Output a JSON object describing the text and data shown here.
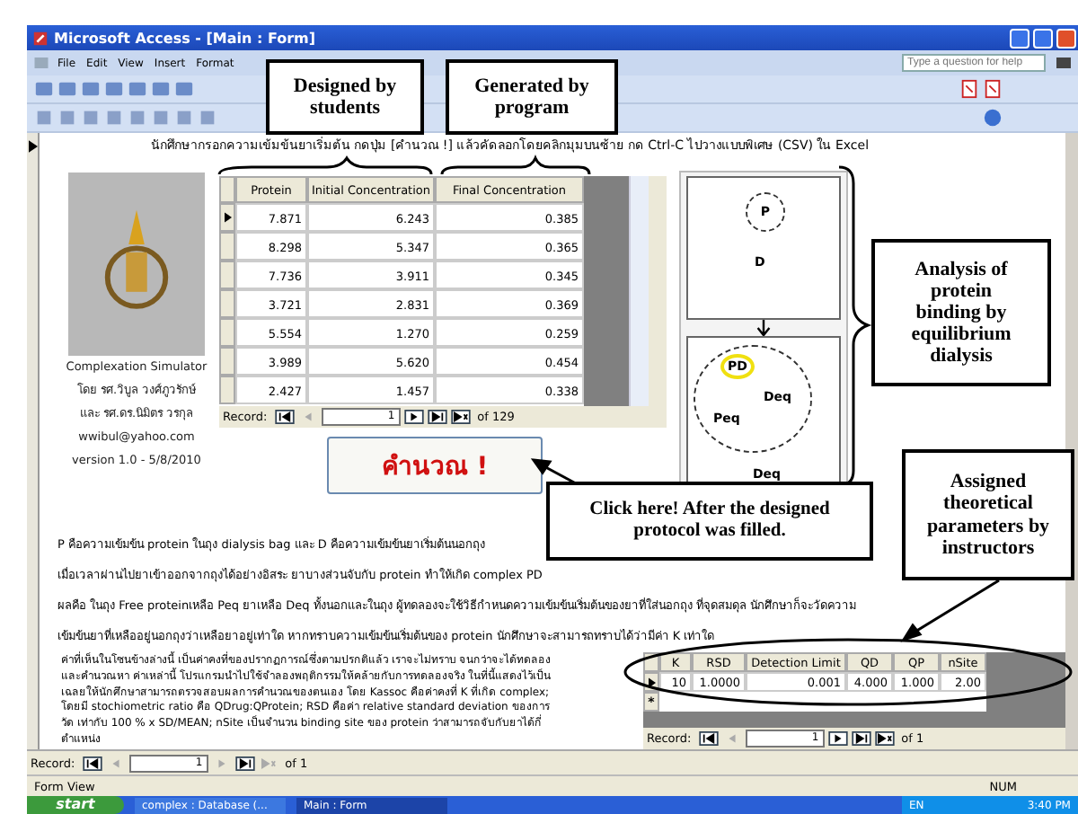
{
  "window": {
    "title": "Microsoft Access - [Main : Form]"
  },
  "menu": [
    "File",
    "Edit",
    "View",
    "Insert",
    "Format"
  ],
  "help_box": {
    "placeholder": "Type a question for help"
  },
  "form": {
    "instruction": "นักศึกษากรอกความเข้มข้นยาเริ่มต้น กดปุ่ม [คำนวณ !]   แล้วคัดลอกโดยคลิกมุมบนซ้าย กด Ctrl-C ไปวางแบบพิเศษ (CSV) ใน Excel",
    "credits": [
      "Complexation Simulator",
      "โดย รศ.วิบูล วงศ์ภูวรักษ์",
      "และ รศ.ดร.นิมิตร วรกุล",
      "wwibul@yahoo.com",
      "version 1.0 - 5/8/2010"
    ],
    "data_table": {
      "columns": [
        "Protein",
        "Initial Concentration",
        "Final Concentration"
      ],
      "rows": [
        {
          "selected": true,
          "cells": [
            "7.871",
            "6.243",
            "0.385"
          ]
        },
        {
          "selected": false,
          "cells": [
            "8.298",
            "5.347",
            "0.365"
          ]
        },
        {
          "selected": false,
          "cells": [
            "7.736",
            "3.911",
            "0.345"
          ]
        },
        {
          "selected": false,
          "cells": [
            "3.721",
            "2.831",
            "0.369"
          ]
        },
        {
          "selected": false,
          "cells": [
            "5.554",
            "1.270",
            "0.259"
          ]
        },
        {
          "selected": false,
          "cells": [
            "3.989",
            "5.620",
            "0.454"
          ]
        },
        {
          "selected": false,
          "cells": [
            "2.427",
            "1.457",
            "0.338"
          ]
        }
      ],
      "record_nav": {
        "label": "Record:",
        "current": "1",
        "total": "of 129"
      }
    },
    "calculate_button": "คำนวณ !",
    "diagram": {
      "protein": "P",
      "drug": "D",
      "complex": "PD",
      "drug_inside": "Deq",
      "protein_inside": "Peq",
      "drug_outside": "Deq"
    },
    "description": [
      "P คือความเข้มข้น protein ในถุง dialysis bag และ D คือความเข้มข้นยาเริ่มต้นนอกถุง",
      "เมื่อเวลาผ่านไปยาเข้าออกจากถุงได้อย่างอิสระ ยาบางส่วนจับกับ protein ทำให้เกิด complex PD",
      "ผลคือ ในถุง Free proteinเหลือ Peq ยาเหลือ Deq ทั้งนอกและในถุง  ผู้ทดลองจะใช้วิธีกำหนดความเข้มข้นเริ่มต้นของยาที่ใส่นอกถุง ที่จุดสมดุล นักศึกษาก็จะวัดความ",
      "เข้มข้นยาที่เหลืออยู่นอกถุงว่าเหลือยาอยู่เท่าใด หากทราบความเข้มข้นเริ่มต้นของ protein นักศึกษาจะสามารถทราบได้ว่ามีค่า K เท่าใด"
    ],
    "notes": "ค่าที่เห็นในโซนข้างล่างนี้ เป็นค่าคงที่ของปรากฏการณ์ซึ่งตามปรกติแล้ว เราจะไม่ทราบ จนกว่าจะได้ทดลองและคำนวณหา ค่าเหล่านี้ โปรแกรมนำไปใช้จำลองพฤติกรรมให้คล้ายกับการทดลองจริง  ในที่นี้แสดงไว้เป็นเฉลยให้นักศึกษาสามารถตรวจสอบผลการคำนวณของตนเอง โดย Kassoc คือค่าคงที่ K ที่เกิด complex; โดยมี stochiometric ratio คือ QDrug:QProtein; RSD คือค่า relative standard deviation ของการวัด เท่ากับ 100 % x SD/MEAN; nSite เป็นจำนวน binding site ของ protein ว่าสามารถจับกับยาได้กี่ตำแหน่ง",
    "parameters": {
      "columns": [
        "K",
        "RSD",
        "Detection Limit",
        "QD",
        "QP",
        "nSite"
      ],
      "rows": [
        {
          "selected": true,
          "cells": [
            "10",
            "1.0000",
            "0.001",
            "4.000",
            "1.000",
            "2.00"
          ]
        }
      ],
      "new_row": "*",
      "record_nav": {
        "label": "Record:",
        "current": "1",
        "total": "of 1"
      }
    }
  },
  "record_nav": {
    "label": "Record:",
    "current": "1",
    "total": "of 1"
  },
  "status_bar": {
    "mode": "Form View",
    "indicator": "NUM"
  },
  "taskbar": {
    "start": "start",
    "tasks": [
      {
        "label": "complex : Database (...",
        "selected": false
      },
      {
        "label": "Main : Form",
        "selected": true
      }
    ],
    "language": "EN",
    "clock": "3:40 PM"
  },
  "annotations": [
    "Designed by students",
    "Generated by program",
    "Analysis of protein binding by equilibrium dialysis",
    "Click here! After the designed protocol was filled.",
    "Assigned theoretical parameters by instructors"
  ]
}
